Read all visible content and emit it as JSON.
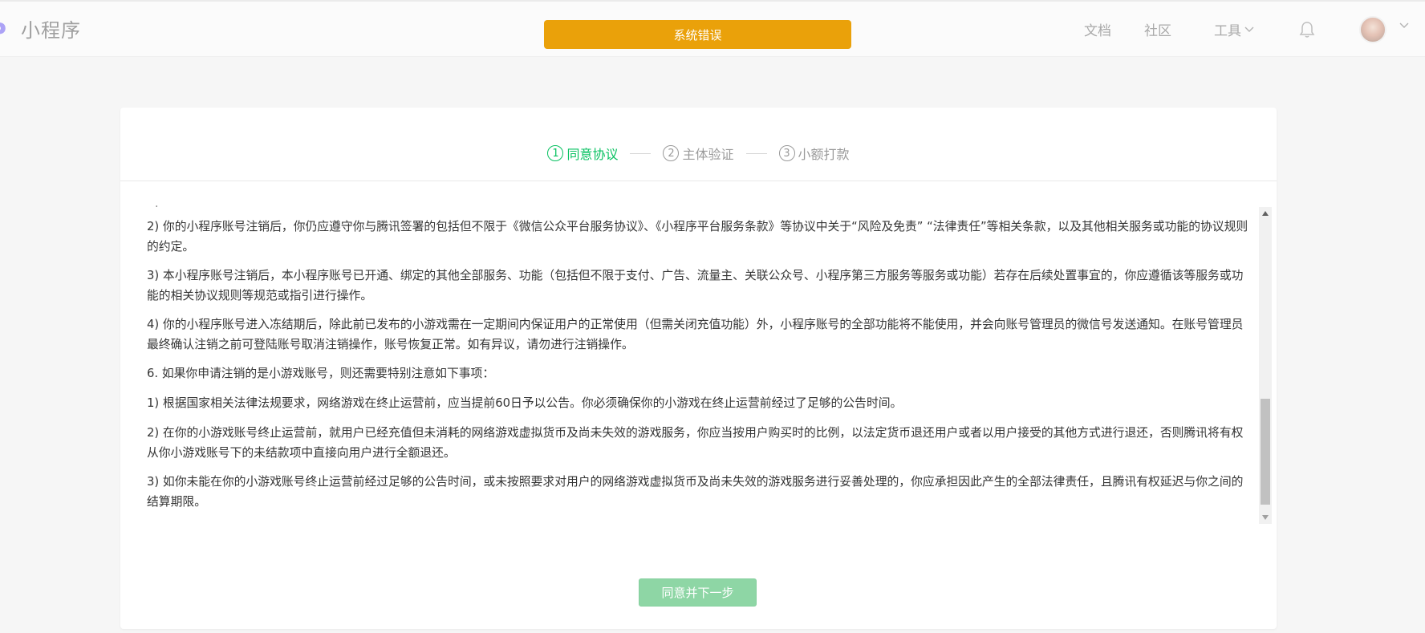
{
  "header": {
    "logo_text": "小程序",
    "nav": {
      "docs": "文档",
      "community": "社区",
      "tools": "工具"
    }
  },
  "toast": {
    "text": "系统错误",
    "color": "#eaa10a"
  },
  "steps": [
    {
      "num": "1",
      "label": "同意协议",
      "state": "active"
    },
    {
      "num": "2",
      "label": "主体验证",
      "state": "pending"
    },
    {
      "num": "3",
      "label": "小额打款",
      "state": "pending"
    }
  ],
  "terms": {
    "dot": ".",
    "paragraphs": [
      "2) 你的小程序账号注销后，你仍应遵守你与腾讯签署的包括但不限于《微信公众平台服务协议》、《小程序平台服务条款》等协议中关于“风险及免责” “法律责任”等相关条款，以及其他相关服务或功能的协议规则的约定。",
      "3) 本小程序账号注销后，本小程序账号已开通、绑定的其他全部服务、功能（包括但不限于支付、广告、流量主、关联公众号、小程序第三方服务等服务或功能）若存在后续处置事宜的，你应遵循该等服务或功能的相关协议规则等规范或指引进行操作。",
      "4) 你的小程序账号进入冻结期后，除此前已发布的小游戏需在一定期间内保证用户的正常使用（但需关闭充值功能）外，小程序账号的全部功能将不能使用，并会向账号管理员的微信号发送通知。在账号管理员最终确认注销之前可登陆账号取消注销操作，账号恢复正常。如有异议，请勿进行注销操作。",
      "6. 如果你申请注销的是小游戏账号，则还需要特别注意如下事项：",
      "1) 根据国家相关法律法规要求，网络游戏在终止运营前，应当提前60日予以公告。你必须确保你的小游戏在终止运营前经过了足够的公告时间。",
      "2) 在你的小游戏账号终止运营前，就用户已经充值但未消耗的网络游戏虚拟货币及尚未失效的游戏服务，你应当按用户购买时的比例，以法定货币退还用户或者以用户接受的其他方式进行退还，否则腾讯将有权从你小游戏账号下的未结款项中直接向用户进行全额退还。",
      "3) 如你未能在你的小游戏账号终止运营前经过足够的公告时间，或未按照要求对用户的网络游戏虚拟货币及尚未失效的游戏服务进行妥善处理的，你应承担因此产生的全部法律责任，且腾讯有权延迟与你之间的结算期限。"
    ]
  },
  "actions": {
    "agree_next": "同意并下一步"
  },
  "colors": {
    "accent": "#07c160",
    "button_disabled": "#8ed6a5"
  }
}
